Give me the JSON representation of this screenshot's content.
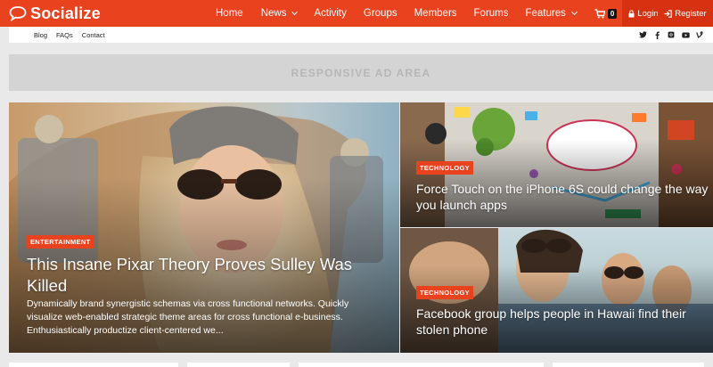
{
  "brand": {
    "name": "Socialize",
    "accent": "#e8421f",
    "accent_dark": "#d63212"
  },
  "nav": {
    "items": [
      {
        "label": "Home",
        "dropdown": false
      },
      {
        "label": "News",
        "dropdown": true
      },
      {
        "label": "Activity",
        "dropdown": false
      },
      {
        "label": "Groups",
        "dropdown": false
      },
      {
        "label": "Members",
        "dropdown": false
      },
      {
        "label": "Forums",
        "dropdown": false
      },
      {
        "label": "Features",
        "dropdown": true
      }
    ],
    "cart_count": "0",
    "login_label": "Login",
    "register_label": "Register"
  },
  "subnav": {
    "links": [
      "Blog",
      "FAQs",
      "Contact"
    ],
    "socials": [
      "twitter-icon",
      "facebook-icon",
      "instagram-icon",
      "youtube-icon",
      "vine-icon"
    ]
  },
  "ad": {
    "label": "RESPONSIVE AD AREA"
  },
  "features": {
    "main": {
      "category": "ENTERTAINMENT",
      "title": "This Insane Pixar Theory Proves Sulley Was Killed",
      "excerpt": "Dynamically brand synergistic schemas via cross functional networks. Quickly visualize web-enabled strategic theme areas for cross functional e-business. Enthusiastically productize client-centered we..."
    },
    "top_right": {
      "category": "TECHNOLOGY",
      "title": "Force Touch on the iPhone 6S could change the way you launch apps"
    },
    "bottom_right": {
      "category": "TECHNOLOGY",
      "title": "Facebook group helps people in Hawaii find their stolen phone"
    }
  }
}
